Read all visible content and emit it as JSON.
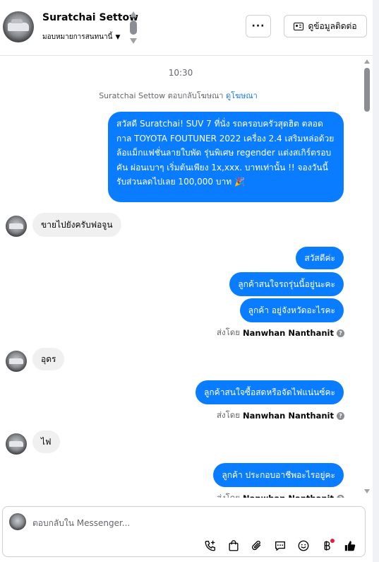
{
  "header": {
    "contact_name": "Suratchai Settow",
    "assign_label": "มอบหมายการสนทนานี้",
    "more_label": "···",
    "view_contact_label": "ดูข้อมูลติดต่อ"
  },
  "thread": {
    "time": "10:30",
    "replied_to_ad": "Suratchai Settow ตอบกลับโฆษณา",
    "view_ad_link": "ดูโฆษณา",
    "messages": [
      {
        "direction": "out",
        "text": "สวัสดี Suratchai! SUV 7 ที่นั่ง รถครอบครัวสุดฮิต ตลอดกาล TOYOTA FOUTUNER 2022 เครื่อง 2.4 เสริมหล่อด้วยล้อแม็กแฟชั่นลายใบพัด รุ่นพิเศษ regender แต่งสเกิร์ตรอบคัน ผ่อนเบาๆ เริ่มต้นเพียง 1x,xxx. บาทเท่านั้น !! จองวันนี้รับส่วนลดไปเลย 100,000 บาท 🎉"
      },
      {
        "direction": "in",
        "text": "ขายไปยังครับฟอจูน"
      },
      {
        "direction": "out",
        "text": "สวัสดีค่ะ"
      },
      {
        "direction": "out",
        "text": "ลูกค้าสนใจรถรุ่นนี้อยู่นะคะ"
      },
      {
        "direction": "out",
        "text": "ลูกค้า อยู่จังหวัดอะไรคะ"
      },
      {
        "direction": "in",
        "text": "อุดร"
      },
      {
        "direction": "out",
        "text": "ลูกค้าสนใจซื้อสดหรือจัดไฟแน่นซ์คะ"
      },
      {
        "direction": "in",
        "text": "ไฟ"
      },
      {
        "direction": "out",
        "text": "ลูกค้า ประกอบอาชีพอะไรอยู่คะ"
      }
    ],
    "sent_by_prefix": "ส่งโดย",
    "sent_by_name": "Nanwhan Nanthanit"
  },
  "composer": {
    "placeholder": "ตอบกลับใน Messenger...",
    "tools": [
      "phone-plus-icon",
      "shopping-bag-icon",
      "paperclip-icon",
      "saved-reply-icon",
      "emoji-icon",
      "baht-payment-icon",
      "like-icon"
    ]
  },
  "colors": {
    "outgoing_bubble": "#0a7cff",
    "incoming_bubble": "#f0f0f0",
    "link": "#1877f2",
    "muted_text": "#65676b"
  }
}
